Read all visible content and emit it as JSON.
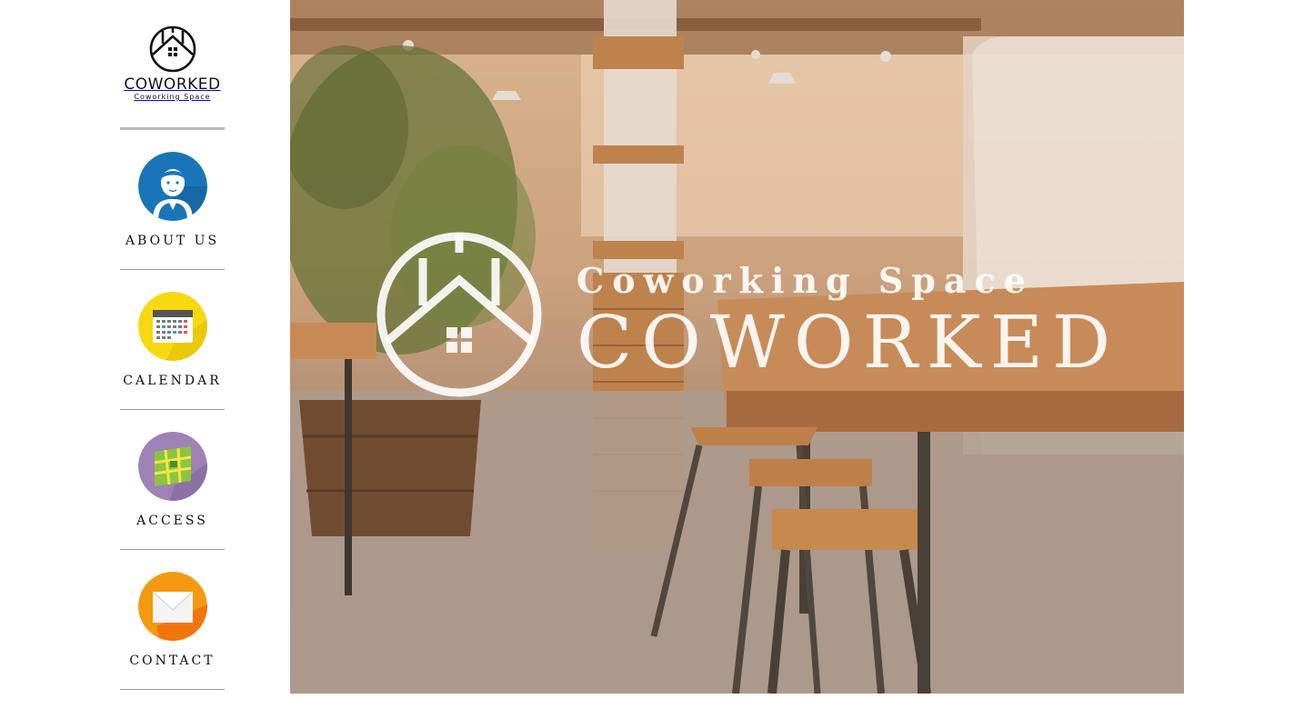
{
  "brand": {
    "name": "COWORKED",
    "tagline": "Coworking Space"
  },
  "nav": {
    "items": [
      {
        "label": "ABOUT US",
        "icon": "person-icon"
      },
      {
        "label": "CALENDAR",
        "icon": "calendar-icon"
      },
      {
        "label": "ACCESS",
        "icon": "map-icon"
      },
      {
        "label": "CONTACT",
        "icon": "envelope-icon"
      }
    ]
  },
  "hero": {
    "subtitle": "Coworking Space",
    "title": "COWORKED"
  },
  "colors": {
    "about_icon_bg": "#1a75b8",
    "calendar_icon_bg": "#f6d90f",
    "access_icon_bg": "#9e82b6",
    "contact_icon_bg": "#f39a12",
    "divider": "#9a9a9a"
  }
}
